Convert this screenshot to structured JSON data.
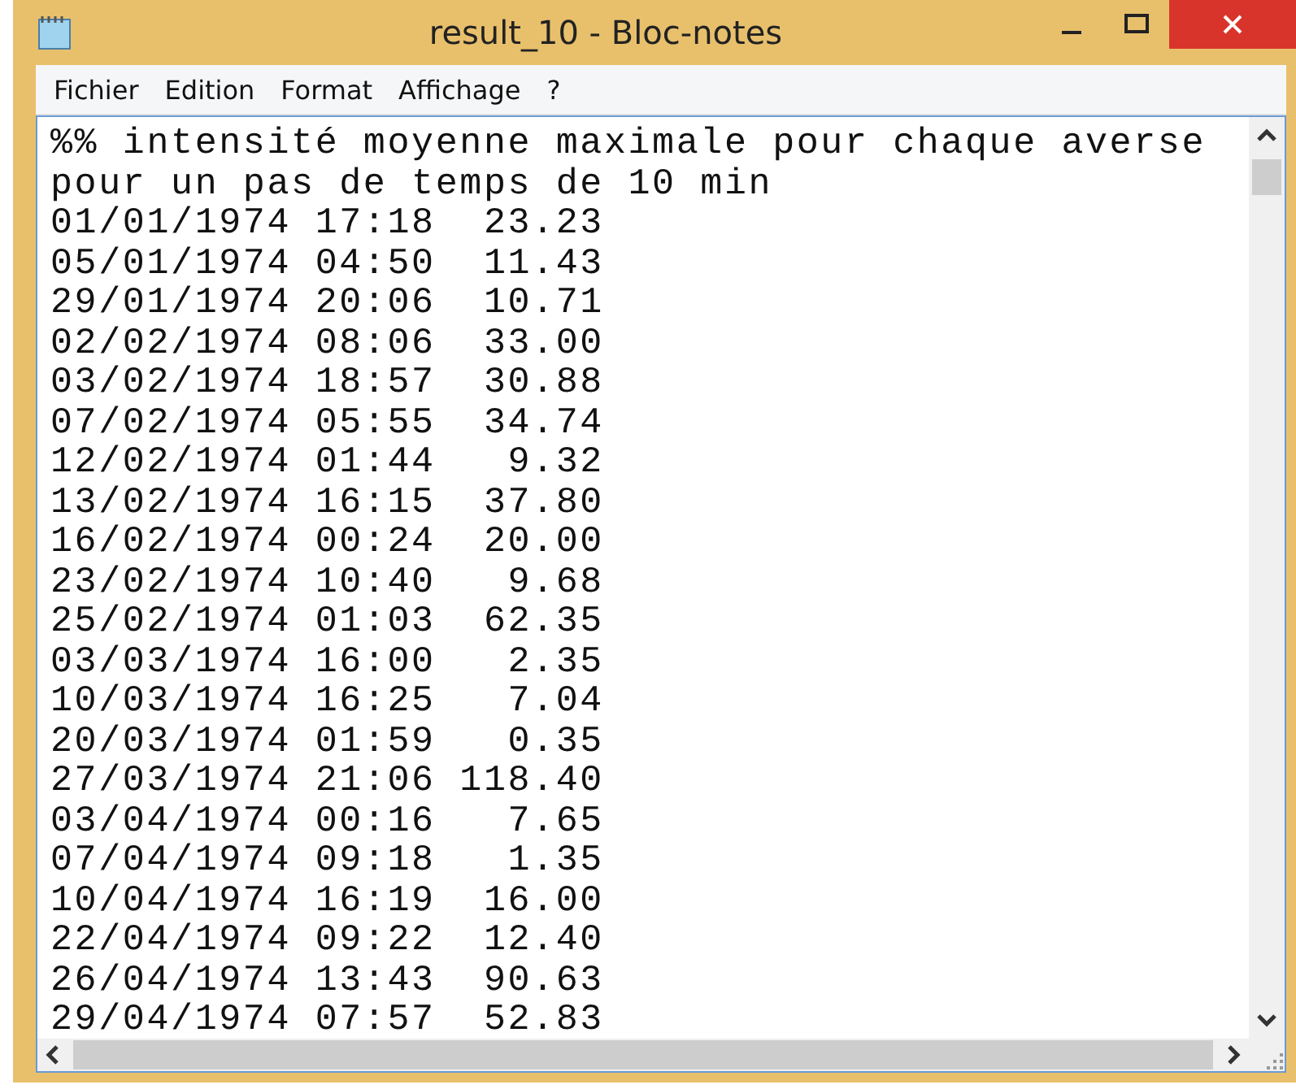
{
  "window": {
    "title": "result_10 - Bloc-notes"
  },
  "menu": [
    "Fichier",
    "Edition",
    "Format",
    "Affichage",
    "?"
  ],
  "document": {
    "lines": [
      "%% intensité moyenne maximale pour chaque averse",
      "pour un pas de temps de 10 min",
      "01/01/1974 17:18  23.23",
      "05/01/1974 04:50  11.43",
      "29/01/1974 20:06  10.71",
      "02/02/1974 08:06  33.00",
      "03/02/1974 18:57  30.88",
      "07/02/1974 05:55  34.74",
      "12/02/1974 01:44   9.32",
      "13/02/1974 16:15  37.80",
      "16/02/1974 00:24  20.00",
      "23/02/1974 10:40   9.68",
      "25/02/1974 01:03  62.35",
      "03/03/1974 16:00   2.35",
      "10/03/1974 16:25   7.04",
      "20/03/1974 01:59   0.35",
      "27/03/1974 21:06 118.40",
      "03/04/1974 00:16   7.65",
      "07/04/1974 09:18   1.35",
      "10/04/1974 16:19  16.00",
      "22/04/1974 09:22  12.40",
      "26/04/1974 13:43  90.63",
      "29/04/1974 07:57  52.83"
    ]
  }
}
